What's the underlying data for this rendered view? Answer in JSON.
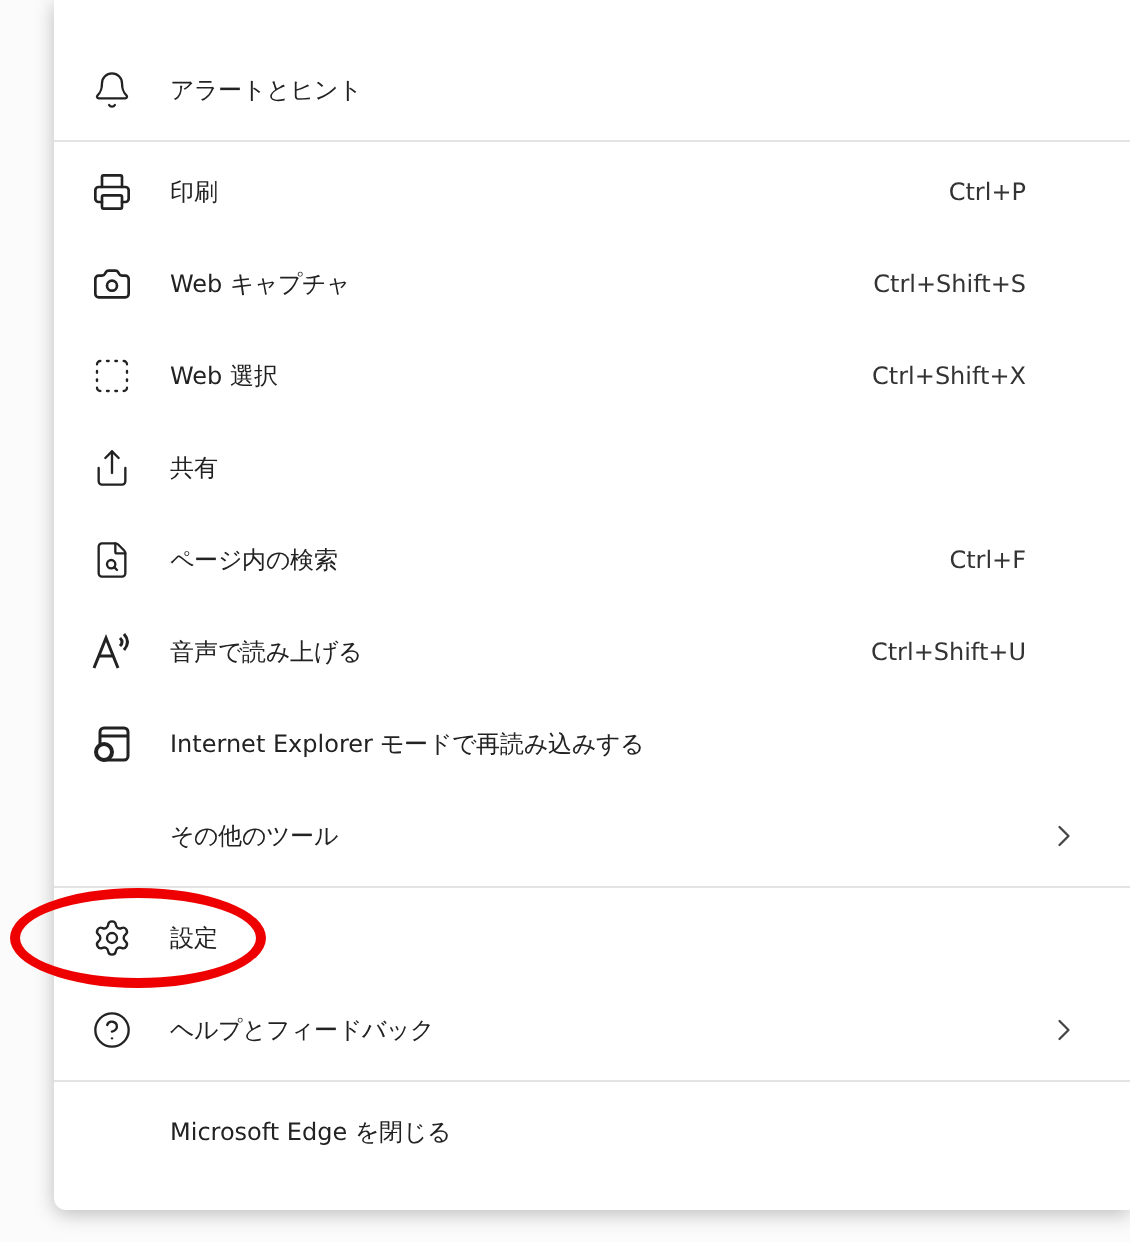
{
  "menu": {
    "sections": [
      {
        "items": [
          {
            "label": "アラートとヒント",
            "submenu": false,
            "highlighted": false
          }
        ]
      },
      {
        "items": [
          {
            "label": "印刷",
            "shortcut": "Ctrl+P",
            "submenu": false,
            "highlighted": false
          },
          {
            "label": "Web キャプチャ",
            "shortcut": "Ctrl+Shift+S",
            "submenu": false,
            "highlighted": false
          },
          {
            "label": "Web 選択",
            "shortcut": "Ctrl+Shift+X",
            "submenu": false,
            "highlighted": false
          },
          {
            "label": "共有",
            "submenu": false,
            "highlighted": false
          },
          {
            "label": "ページ内の検索",
            "shortcut": "Ctrl+F",
            "submenu": false,
            "highlighted": false
          },
          {
            "label": "音声で読み上げる",
            "shortcut": "Ctrl+Shift+U",
            "submenu": false,
            "highlighted": false
          },
          {
            "label": "Internet Explorer モードで再読み込みする",
            "submenu": false,
            "highlighted": false
          },
          {
            "label": "その他のツール",
            "submenu": true,
            "highlighted": false
          }
        ]
      },
      {
        "items": [
          {
            "label": "設定",
            "submenu": false,
            "highlighted": true
          },
          {
            "label": "ヘルプとフィードバック",
            "submenu": true,
            "highlighted": false
          }
        ]
      },
      {
        "items": [
          {
            "label": "Microsoft Edge を閉じる",
            "submenu": false,
            "highlighted": false
          }
        ]
      }
    ]
  }
}
